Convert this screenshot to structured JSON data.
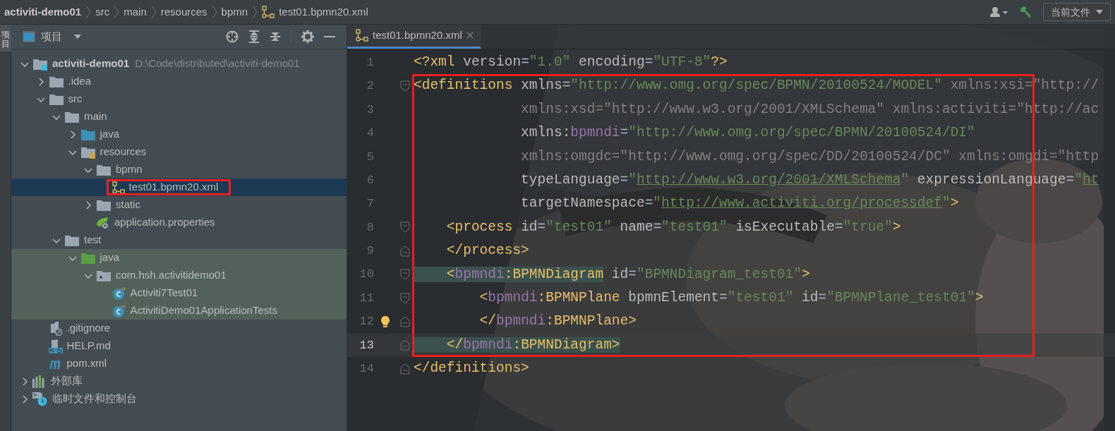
{
  "breadcrumb": [
    {
      "label": "activiti-demo01",
      "kind": "project"
    },
    {
      "label": "src",
      "kind": "folder"
    },
    {
      "label": "main",
      "kind": "folder"
    },
    {
      "label": "resources",
      "kind": "folder"
    },
    {
      "label": "bpmn",
      "kind": "folder"
    },
    {
      "label": "test01.bpmn20.xml",
      "kind": "file"
    }
  ],
  "toolbar": {
    "run_config": "当前文件"
  },
  "side_tab": {
    "label": "项目"
  },
  "project_panel": {
    "title": "项目",
    "tree": [
      {
        "label": "activiti-demo01",
        "kind": "module",
        "hint": "D:\\Code\\distributed\\activiti-demo01",
        "expanded": true,
        "selected": false,
        "children": [
          {
            "label": ".idea",
            "kind": "folder",
            "expanded": false,
            "selected": false
          },
          {
            "label": "src",
            "kind": "folder",
            "expanded": true,
            "selected": false,
            "children": [
              {
                "label": "main",
                "kind": "folder",
                "expanded": true,
                "selected": false,
                "children": [
                  {
                    "label": "java",
                    "kind": "source",
                    "expanded": false,
                    "selected": false
                  },
                  {
                    "label": "resources",
                    "kind": "resources",
                    "expanded": true,
                    "selected": false,
                    "children": [
                      {
                        "label": "bpmn",
                        "kind": "folder",
                        "expanded": true,
                        "selected": false,
                        "children": [
                          {
                            "label": "test01.bpmn20.xml",
                            "kind": "bpmn",
                            "selected": true,
                            "highlighted": true
                          }
                        ]
                      },
                      {
                        "label": "static",
                        "kind": "folder",
                        "expanded": false,
                        "selected": false
                      },
                      {
                        "label": "application.properties",
                        "kind": "spring",
                        "selected": false
                      }
                    ]
                  }
                ]
              },
              {
                "label": "test",
                "kind": "folder",
                "expanded": true,
                "selected": false,
                "children": [
                  {
                    "label": "java",
                    "kind": "testsource",
                    "expanded": true,
                    "selected": false,
                    "tinted": true,
                    "children": [
                      {
                        "label": "com.hsh.activitidemo01",
                        "kind": "package",
                        "expanded": true,
                        "selected": false,
                        "tinted": true,
                        "children": [
                          {
                            "label": "Activiti7Test01",
                            "kind": "class",
                            "selected": false,
                            "tinted": true
                          },
                          {
                            "label": "ActivitiDemo01ApplicationTests",
                            "kind": "class",
                            "selected": false,
                            "tinted": true
                          }
                        ]
                      }
                    ]
                  }
                ]
              }
            ]
          },
          {
            "label": ".gitignore",
            "kind": "gitignore",
            "selected": false
          },
          {
            "label": "HELP.md",
            "kind": "md",
            "selected": false
          },
          {
            "label": "pom.xml",
            "kind": "maven",
            "selected": false
          }
        ]
      },
      {
        "label": "外部库",
        "kind": "library",
        "expanded": false,
        "selected": false
      },
      {
        "label": "临时文件和控制台",
        "kind": "scratch",
        "expanded": false,
        "selected": false
      }
    ]
  },
  "editor": {
    "tabs": [
      {
        "label": "test01.bpmn20.xml",
        "selected": true
      }
    ],
    "lines": [
      {
        "number": "1",
        "kind": "plain",
        "tokens": [
          {
            "kind": "tag",
            "text": "<?xml "
          },
          {
            "kind": "attr",
            "text": "version"
          },
          {
            "kind": "plain",
            "text": "="
          },
          {
            "kind": "string",
            "text": "\"1.0\" "
          },
          {
            "kind": "attr",
            "text": "encoding"
          },
          {
            "kind": "plain",
            "text": "="
          },
          {
            "kind": "string",
            "text": "\"UTF-8\""
          },
          {
            "kind": "tag",
            "text": "?>"
          }
        ]
      },
      {
        "number": "2",
        "kind": "fold-start",
        "highlighted": true,
        "tokens": [
          {
            "kind": "tag",
            "text": "<definitions "
          },
          {
            "kind": "attr",
            "text": "xmlns"
          },
          {
            "kind": "plain",
            "text": "="
          },
          {
            "kind": "string",
            "text": "\"http://www.omg.org/spec/BPMN/20100524/MODEL\" "
          },
          {
            "kind": "unused",
            "text": "xmlns:xsi=\"http://"
          }
        ]
      },
      {
        "number": "3",
        "kind": "plain",
        "highlighted": true,
        "tokens": [
          {
            "kind": "unused",
            "text": "             xmlns:xsd=\"http://www.w3.org/2001/XMLSchema\" xmlns:activiti=\"http://ac"
          }
        ]
      },
      {
        "number": "4",
        "kind": "plain",
        "highlighted": true,
        "tokens": [
          {
            "kind": "attr",
            "text": "             xmlns:"
          },
          {
            "kind": "ns",
            "text": "bpmndi"
          },
          {
            "kind": "plain",
            "text": "="
          },
          {
            "kind": "string",
            "text": "\"http://www.omg.org/spec/BPMN/20100524/DI\""
          }
        ]
      },
      {
        "number": "5",
        "kind": "plain",
        "highlighted": true,
        "tokens": [
          {
            "kind": "unused",
            "text": "             xmlns:omgdc=\"http://www.omg.org/spec/DD/20100524/DC\" xmlns:omgdi=\"http"
          }
        ]
      },
      {
        "number": "6",
        "kind": "plain",
        "highlighted": true,
        "tokens": [
          {
            "kind": "attr",
            "text": "             typeLanguage"
          },
          {
            "kind": "plain",
            "text": "="
          },
          {
            "kind": "string",
            "text": "\""
          },
          {
            "kind": "link",
            "text": "http://www.w3.org/2001/XMLSchema"
          },
          {
            "kind": "string",
            "text": "\" "
          },
          {
            "kind": "attr",
            "text": "expressionLanguage"
          },
          {
            "kind": "plain",
            "text": "="
          },
          {
            "kind": "string",
            "text": "\""
          },
          {
            "kind": "link",
            "text": "ht"
          }
        ]
      },
      {
        "number": "7",
        "kind": "plain",
        "highlighted": true,
        "tokens": [
          {
            "kind": "attr",
            "text": "             targetNamespace"
          },
          {
            "kind": "plain",
            "text": "="
          },
          {
            "kind": "string",
            "text": "\""
          },
          {
            "kind": "link",
            "text": "http://www.activiti.org/processdef"
          },
          {
            "kind": "string",
            "text": "\""
          },
          {
            "kind": "tag",
            "text": ">"
          }
        ]
      },
      {
        "number": "8",
        "kind": "fold-start",
        "highlighted": true,
        "tokens": [
          {
            "kind": "tag",
            "text": "    <process "
          },
          {
            "kind": "attr",
            "text": "id"
          },
          {
            "kind": "plain",
            "text": "="
          },
          {
            "kind": "string",
            "text": "\"test01\" "
          },
          {
            "kind": "attr",
            "text": "name"
          },
          {
            "kind": "plain",
            "text": "="
          },
          {
            "kind": "string",
            "text": "\"test01\" "
          },
          {
            "kind": "attr",
            "text": "isExecutable"
          },
          {
            "kind": "plain",
            "text": "="
          },
          {
            "kind": "string",
            "text": "\"true\""
          },
          {
            "kind": "tag",
            "text": ">"
          }
        ]
      },
      {
        "number": "9",
        "kind": "fold-end",
        "highlighted": true,
        "tokens": [
          {
            "kind": "tag",
            "text": "    </process>"
          }
        ]
      },
      {
        "number": "10",
        "kind": "fold-start",
        "highlighted": true,
        "tokens": [
          {
            "kind": "tag",
            "text": "    <",
            "matched": true
          },
          {
            "kind": "ns",
            "text": "bpmndi",
            "matched": true
          },
          {
            "kind": "tag",
            "text": ":BPMNDiagram",
            "matched": true
          },
          {
            "kind": "attr",
            "text": " id"
          },
          {
            "kind": "plain",
            "text": "="
          },
          {
            "kind": "string",
            "text": "\"BPMNDiagram_test01\""
          },
          {
            "kind": "tag",
            "text": ">"
          }
        ]
      },
      {
        "number": "11",
        "kind": "fold-start",
        "highlighted": true,
        "tokens": [
          {
            "kind": "tag",
            "text": "        <"
          },
          {
            "kind": "ns",
            "text": "bpmndi"
          },
          {
            "kind": "tag",
            "text": ":BPMNPlane "
          },
          {
            "kind": "attr",
            "text": "bpmnElement"
          },
          {
            "kind": "plain",
            "text": "="
          },
          {
            "kind": "string",
            "text": "\"test01\" "
          },
          {
            "kind": "attr",
            "text": "id"
          },
          {
            "kind": "plain",
            "text": "="
          },
          {
            "kind": "string",
            "text": "\"BPMNPlane_test01\""
          },
          {
            "kind": "tag",
            "text": ">"
          }
        ]
      },
      {
        "number": "12",
        "kind": "fold-end",
        "highlighted": true,
        "intention": true,
        "tokens": [
          {
            "kind": "tag",
            "text": "        </"
          },
          {
            "kind": "ns",
            "text": "bpmndi"
          },
          {
            "kind": "tag",
            "text": ":BPMNPlane>"
          }
        ]
      },
      {
        "number": "13",
        "kind": "fold-end",
        "highlighted": true,
        "current": true,
        "tokens": [
          {
            "kind": "tag",
            "text": "    </",
            "matched": true
          },
          {
            "kind": "ns",
            "text": "bpmndi",
            "matched": true
          },
          {
            "kind": "tag",
            "text": ":BPMNDiagram>",
            "matched": true
          }
        ]
      },
      {
        "number": "14",
        "kind": "fold-end",
        "tokens": [
          {
            "kind": "tag",
            "text": "</definitions>"
          }
        ]
      }
    ]
  }
}
